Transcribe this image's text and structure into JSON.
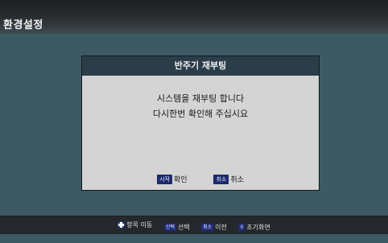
{
  "header": {
    "title": "환경설정"
  },
  "dialog": {
    "title": "반주기 재부팅",
    "message_line1": "시스템을 재부팅 합니다",
    "message_line2": "다시한번 확인해 주십시요",
    "confirm_key": "시작",
    "confirm_label": "확인",
    "cancel_key": "취소",
    "cancel_label": "취소"
  },
  "footer": {
    "hints": [
      {
        "key": "",
        "icon": "directional-pad-icon",
        "label": "항목 이동"
      },
      {
        "key": "선택",
        "label": "선택"
      },
      {
        "key": "취소",
        "label": "이전"
      },
      {
        "key": "0",
        "label": "초기화면"
      }
    ]
  },
  "colors": {
    "background": "#3d5a64",
    "dialog_header": "#2a3d49",
    "dialog_body": "#d4d4d4",
    "key_badge": "#1c2a6e"
  }
}
